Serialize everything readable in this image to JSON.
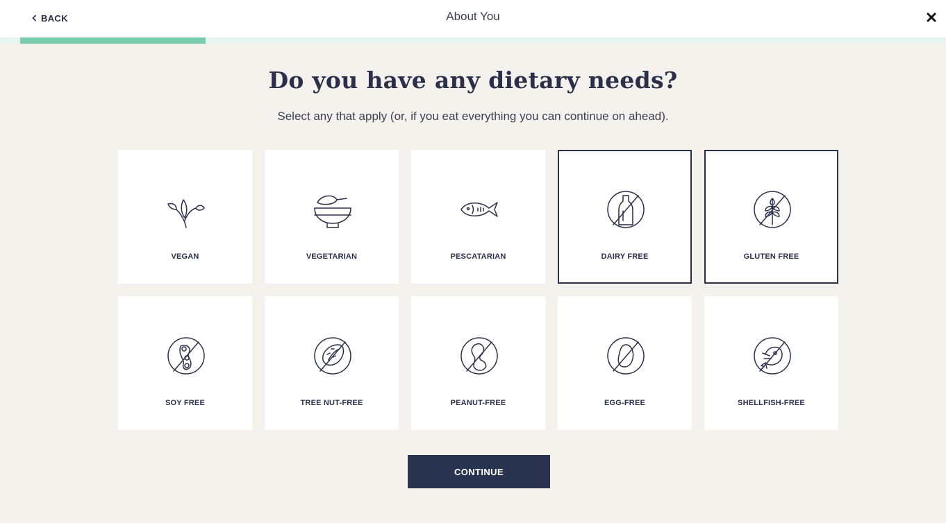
{
  "header": {
    "back_label": "BACK",
    "title": "About You",
    "close_icon": "close-x-icon"
  },
  "progress": {
    "fraction": 0.2
  },
  "main": {
    "heading": "Do you have any dietary needs?",
    "subheading": "Select any that apply (or, if you eat everything you can continue on ahead).",
    "options": [
      {
        "label": "VEGAN",
        "icon": "plant-sprout-icon",
        "selected": false
      },
      {
        "label": "VEGETARIAN",
        "icon": "bowl-icon",
        "selected": false
      },
      {
        "label": "PESCATARIAN",
        "icon": "fish-icon",
        "selected": false
      },
      {
        "label": "DAIRY FREE",
        "icon": "no-milk-bottle-icon",
        "selected": true
      },
      {
        "label": "GLUTEN FREE",
        "icon": "no-wheat-icon",
        "selected": true
      },
      {
        "label": "SOY FREE",
        "icon": "no-soybean-icon",
        "selected": false
      },
      {
        "label": "TREE NUT-FREE",
        "icon": "no-almond-icon",
        "selected": false
      },
      {
        "label": "PEANUT-FREE",
        "icon": "no-peanut-icon",
        "selected": false
      },
      {
        "label": "EGG-FREE",
        "icon": "no-egg-icon",
        "selected": false
      },
      {
        "label": "SHELLFISH-FREE",
        "icon": "no-shrimp-icon",
        "selected": false
      }
    ],
    "continue_label": "CONTINUE"
  },
  "colors": {
    "accent": "#7ccdb0",
    "primary": "#2a3350",
    "background": "#f5f2ee"
  }
}
